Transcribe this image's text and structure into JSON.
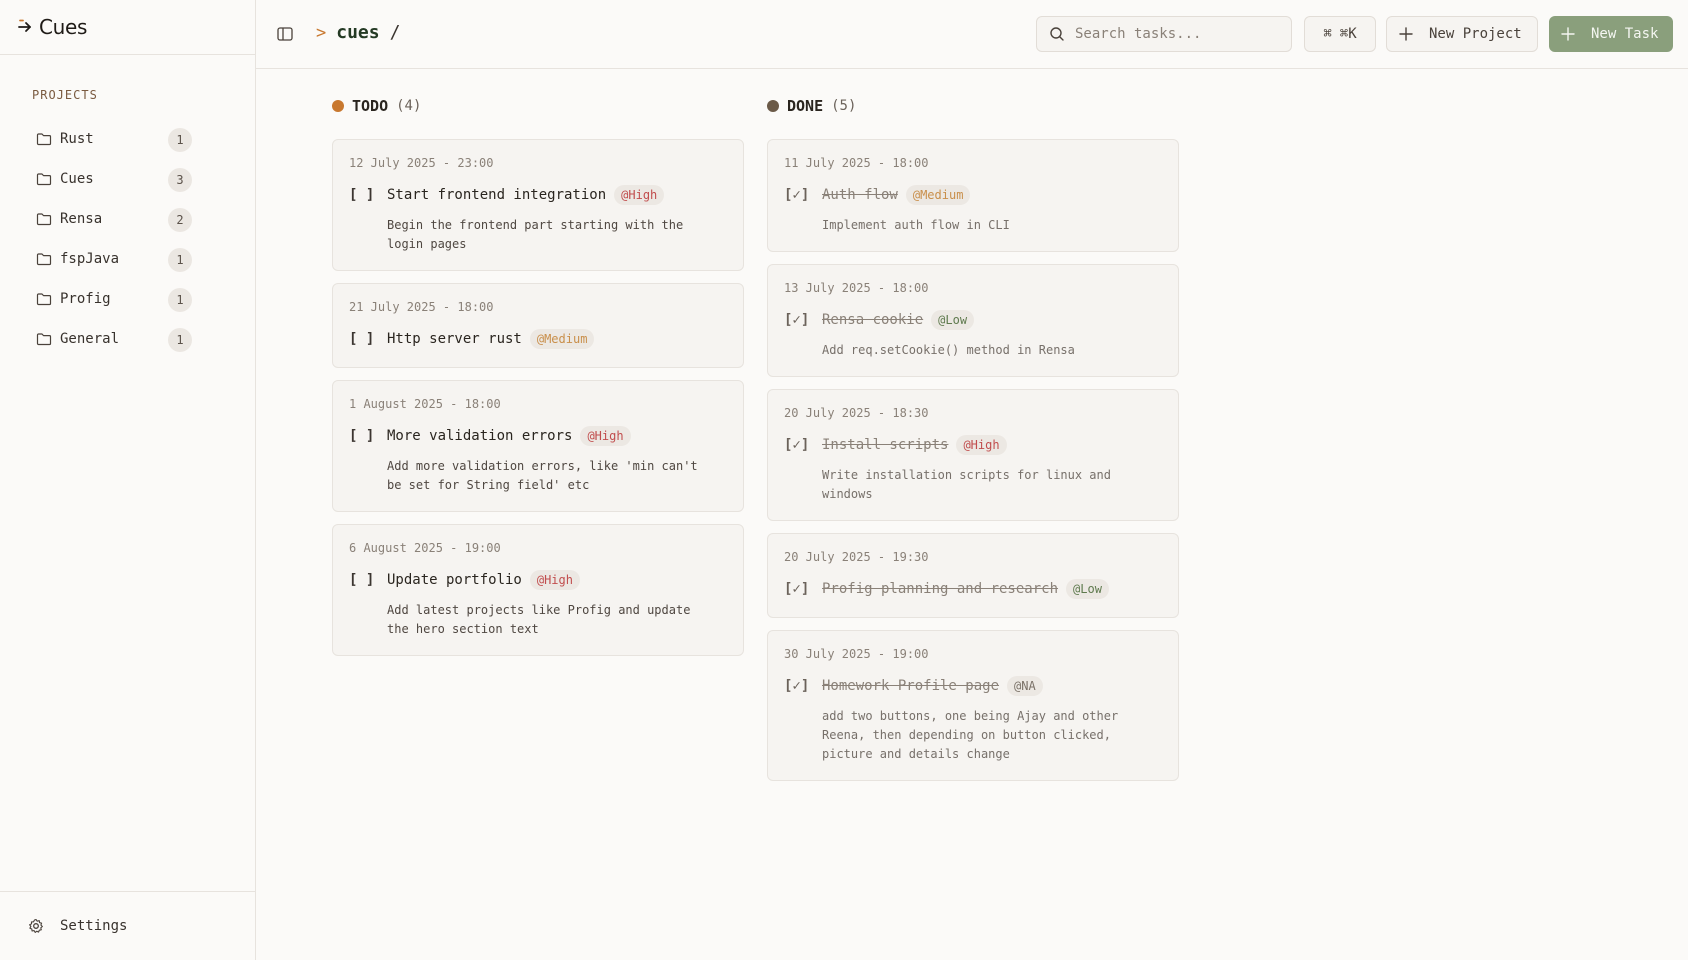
{
  "app": {
    "name": "Cues"
  },
  "sidebar": {
    "section_title": "PROJECTS",
    "projects": [
      {
        "name": "Rust",
        "count": "1"
      },
      {
        "name": "Cues",
        "count": "3"
      },
      {
        "name": "Rensa",
        "count": "2"
      },
      {
        "name": "fspJava",
        "count": "1"
      },
      {
        "name": "Profig",
        "count": "1"
      },
      {
        "name": "General",
        "count": "1"
      }
    ],
    "settings_label": "Settings"
  },
  "header": {
    "breadcrumb_chevron": ">",
    "project": "cues",
    "separator": "/",
    "search_placeholder": "Search tasks...",
    "shortcut_label": "⌘K",
    "new_project_label": "New Project",
    "new_task_label": "New Task"
  },
  "colors": {
    "todo_dot": "#c8782f",
    "done_dot": "#6b5a48",
    "primary_button": "#8a9f7c"
  },
  "columns": {
    "todo": {
      "title": "TODO",
      "count": "(4)",
      "cards": [
        {
          "date": "12 July 2025 - 23:00",
          "check": "[ ]",
          "title": "Start frontend integration",
          "priority": "@High",
          "desc": "Begin the frontend part starting with the login pages"
        },
        {
          "date": "21 July 2025 - 18:00",
          "check": "[ ]",
          "title": "Http server rust",
          "priority": "@Medium",
          "desc": ""
        },
        {
          "date": "1 August 2025 - 18:00",
          "check": "[ ]",
          "title": "More validation errors",
          "priority": "@High",
          "desc": "Add more validation errors, like 'min can't be set for String field' etc"
        },
        {
          "date": "6 August 2025 - 19:00",
          "check": "[ ]",
          "title": "Update portfolio",
          "priority": "@High",
          "desc": "Add latest projects like Profig and update the hero section text"
        }
      ]
    },
    "done": {
      "title": "DONE",
      "count": "(5)",
      "cards": [
        {
          "date": "11 July 2025 - 18:00",
          "check": "[✓]",
          "title": "Auth flow",
          "priority": "@Medium",
          "desc": "Implement auth flow in CLI"
        },
        {
          "date": "13 July 2025 - 18:00",
          "check": "[✓]",
          "title": "Rensa cookie",
          "priority": "@Low",
          "desc": "Add req.setCookie() method in Rensa"
        },
        {
          "date": "20 July 2025 - 18:30",
          "check": "[✓]",
          "title": "Install scripts",
          "priority": "@High",
          "desc": "Write installation scripts for linux and windows"
        },
        {
          "date": "20 July 2025 - 19:30",
          "check": "[✓]",
          "title": "Profig planning and research",
          "priority": "@Low",
          "desc": ""
        },
        {
          "date": "30 July 2025 - 19:00",
          "check": "[✓]",
          "title": "Homework Profile page",
          "priority": "@NA",
          "desc": "add two buttons, one being Ajay and other Reena, then depending on button clicked, picture and details change"
        }
      ]
    }
  }
}
